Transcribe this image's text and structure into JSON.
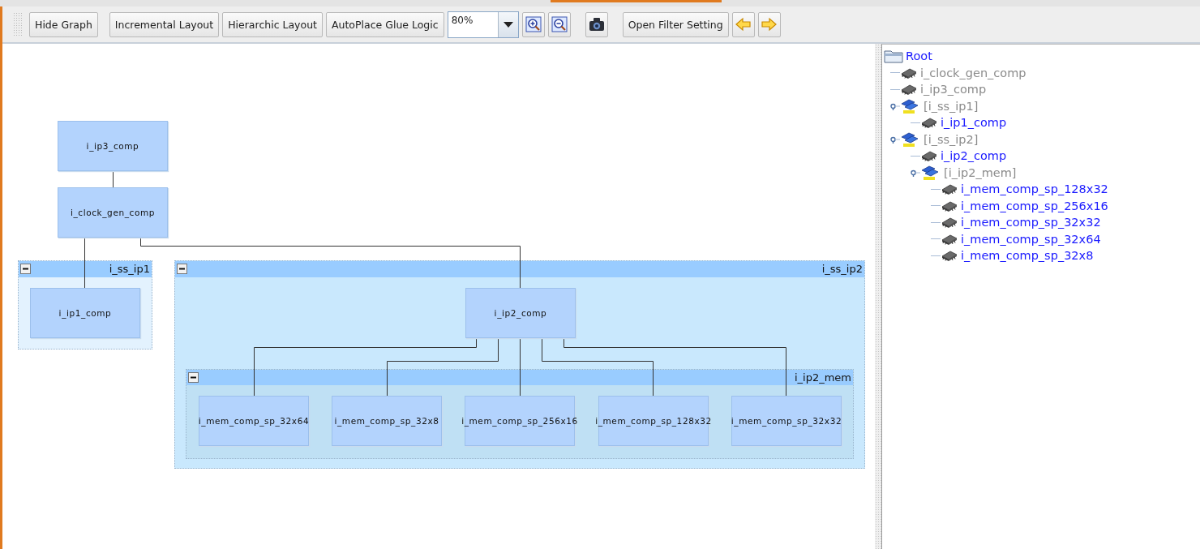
{
  "toolbar": {
    "items": [
      {
        "kind": "button",
        "label": "Hide Graph"
      },
      {
        "kind": "button",
        "label": "Incremental Layout"
      },
      {
        "kind": "button",
        "label": "Hierarchic Layout"
      },
      {
        "kind": "button",
        "label": "AutoPlace Glue Logic"
      },
      {
        "kind": "combo",
        "value": "80%"
      },
      {
        "kind": "zoomin"
      },
      {
        "kind": "zoomout"
      },
      {
        "kind": "camera"
      },
      {
        "kind": "button",
        "label": "Open Filter Setting"
      },
      {
        "kind": "back"
      },
      {
        "kind": "forward"
      }
    ]
  },
  "graph": {
    "nodes": [
      "i_ip3_comp",
      "i_clock_gen_comp",
      "i_ip1_comp",
      "i_ip2_comp",
      "i_mem_comp_sp_32x64",
      "i_mem_comp_sp_32x8",
      "i_mem_comp_sp_256x16",
      "i_mem_comp_sp_128x32",
      "i_mem_comp_sp_32x32"
    ],
    "groups": [
      {
        "label": "i_ss_ip1",
        "expanded": true
      },
      {
        "label": "i_ss_ip2",
        "expanded": true
      },
      {
        "label": "i_ip2_mem",
        "expanded": true
      }
    ]
  },
  "tree": {
    "label": "Root",
    "children": [
      {
        "kind": "chip",
        "label": "i_clock_gen_comp",
        "dimmed": true
      },
      {
        "kind": "chip",
        "label": "i_ip3_comp",
        "dimmed": true
      },
      {
        "kind": "group",
        "label": "[i_ss_ip1]",
        "dimmed": true,
        "expanded": true,
        "children": [
          {
            "kind": "chip",
            "label": "i_ip1_comp",
            "dimmed": false
          }
        ]
      },
      {
        "kind": "group",
        "label": "[i_ss_ip2]",
        "dimmed": true,
        "expanded": true,
        "children": [
          {
            "kind": "chip",
            "label": "i_ip2_comp",
            "dimmed": false
          },
          {
            "kind": "group",
            "label": "[i_ip2_mem]",
            "dimmed": true,
            "expanded": true,
            "children": [
              {
                "kind": "chip",
                "label": "i_mem_comp_sp_128x32",
                "dimmed": false
              },
              {
                "kind": "chip",
                "label": "i_mem_comp_sp_256x16",
                "dimmed": false
              },
              {
                "kind": "chip",
                "label": "i_mem_comp_sp_32x32",
                "dimmed": false
              },
              {
                "kind": "chip",
                "label": "i_mem_comp_sp_32x64",
                "dimmed": false
              },
              {
                "kind": "chip",
                "label": "i_mem_comp_sp_32x8",
                "dimmed": false
              }
            ]
          }
        ]
      }
    ]
  }
}
